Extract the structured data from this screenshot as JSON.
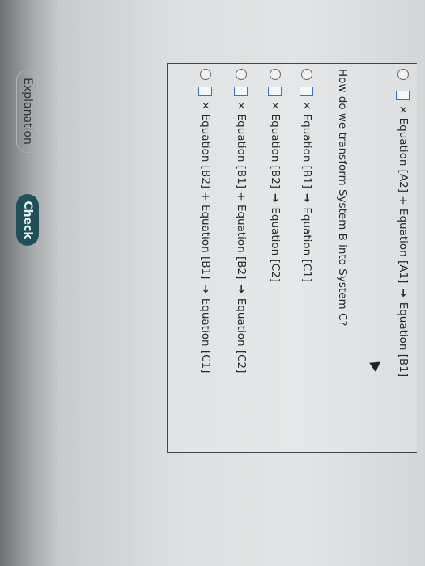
{
  "prev_option": {
    "text": "× Equation [A2] + Equation [A1]",
    "arrow": "→",
    "target": "Equation [B1]"
  },
  "question": "How do we transform System B into System C?",
  "options": [
    {
      "text": "× Equation [B1]",
      "arrow": "→",
      "target": "Equation [C1]"
    },
    {
      "text": "× Equation [B2]",
      "arrow": "→",
      "target": "Equation [C2]"
    },
    {
      "text": "× Equation [B1] + Equation [B2]",
      "arrow": "→",
      "target": "Equation [C2]"
    },
    {
      "text": "× Equation [B2] + Equation [B1]",
      "arrow": "→",
      "target": "Equation [C1]"
    }
  ],
  "buttons": {
    "explanation": "Explanation",
    "check": "Check"
  },
  "colors": {
    "check_bg": "#1f4f59",
    "input_box_border": "#3b6fd2"
  }
}
